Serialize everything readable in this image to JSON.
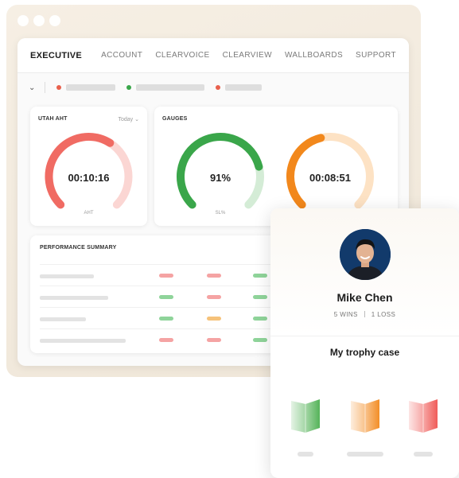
{
  "nav": {
    "brand": "EXECUTIVE",
    "links": [
      "ACCOUNT",
      "CLEARVOICE",
      "CLEARVIEW",
      "WALLBOARDS",
      "SUPPORT"
    ]
  },
  "filters": {
    "colors": [
      "#e8604c",
      "#3aa64a",
      "#e8604c"
    ]
  },
  "aht_card": {
    "title": "UTAH AHT",
    "period": "Today ⌄",
    "value": "00:10:16",
    "label": "AHT",
    "fill_fraction": 0.62,
    "color": "#f06b63",
    "track_color": "#fbd6d3"
  },
  "gauges_card": {
    "title": "GAUGES",
    "gauges": [
      {
        "value": "91%",
        "label": "SL%",
        "fill_fraction": 0.78,
        "color": "#3aa64a",
        "track_color": "#d4ecd6"
      },
      {
        "value": "00:08:51",
        "label": "",
        "fill_fraction": 0.45,
        "color": "#f2881c",
        "track_color": "#fde2c4"
      }
    ]
  },
  "performance": {
    "title": "PERFORMANCE SUMMARY",
    "rows": [
      [
        "#f5a3a3",
        "#f5a3a3",
        "#8fd49a"
      ],
      [
        "#8fd49a",
        "#f5a3a3",
        "#8fd49a"
      ],
      [
        "#8fd49a",
        "#f6c27a",
        "#8fd49a"
      ],
      [
        "#f5a3a3",
        "#f5a3a3",
        "#8fd49a"
      ]
    ]
  },
  "profile": {
    "name": "Mike Chen",
    "wins": "5 WINS",
    "losses": "1 LOSS",
    "trophy_title": "My trophy case",
    "trophies": [
      {
        "icon": "trophy-green-icon",
        "color": "#4caf50"
      },
      {
        "icon": "trophy-orange-icon",
        "color": "#f2881c"
      },
      {
        "icon": "trophy-red-icon",
        "color": "#ef5350"
      }
    ]
  }
}
